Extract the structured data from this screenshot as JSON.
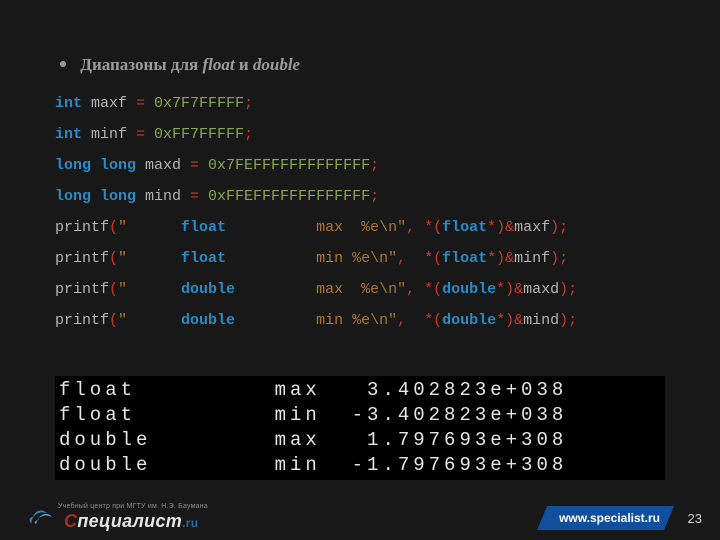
{
  "title": "Диапазоны для float и double",
  "code": {
    "l1": {
      "kw": "int",
      "id": " maxf ",
      "eq": "= ",
      "num": "0x7F7FFFFF",
      "sc": ";"
    },
    "l2": {
      "kw": "int",
      "id": " minf ",
      "eq": "= ",
      "num": "0xFF7FFFFF",
      "sc": ";"
    },
    "l3": {
      "kw": "long long",
      "id": " maxd ",
      "eq": "= ",
      "num": "0x7FEFFFFFFFFFFFFF",
      "sc": ";"
    },
    "l4": {
      "kw": "long long",
      "id": " mind ",
      "eq": "= ",
      "num": "0xFFEFFFFFFFFFFFFF",
      "sc": ";"
    },
    "l5": {
      "fn": "printf",
      "open": "(",
      "s1": "\"      ",
      "ty": "float",
      "s2": "          max  %e\\n\"",
      "com": ", ",
      "star": "*(",
      "ty2": "float",
      "cast": "*)&",
      "var": "maxf",
      "close": ");"
    },
    "l6": {
      "fn": "printf",
      "open": "(",
      "s1": "\"      ",
      "ty": "float",
      "s2": "          min %e\\n\"",
      "com": ",  ",
      "star": "*(",
      "ty2": "float",
      "cast": "*)&",
      "var": "minf",
      "close": ");"
    },
    "l7": {
      "fn": "printf",
      "open": "(",
      "s1": "\"      ",
      "ty": "double",
      "s2": "         max  %e\\n\"",
      "com": ", ",
      "star": "*(",
      "ty2": "double",
      "cast": "*)&",
      "var": "maxd",
      "close": ");"
    },
    "l8": {
      "fn": "printf",
      "open": "(",
      "s1": "\"      ",
      "ty": "double",
      "s2": "         min %e\\n\"",
      "com": ",  ",
      "star": "*(",
      "ty2": "double",
      "cast": "*)&",
      "var": "mind",
      "close": ");"
    }
  },
  "output": "float         max   3.402823e+038\nfloat         min  -3.402823e+038\ndouble        max   1.797693e+308\ndouble        min  -1.797693e+308",
  "logo": {
    "sub": "Учебный центр при МГТУ им. Н.Э. Баумана",
    "c": "С",
    "main": "пециалист",
    "ru": ".ru"
  },
  "url": "www.specialist.ru",
  "page": "23"
}
